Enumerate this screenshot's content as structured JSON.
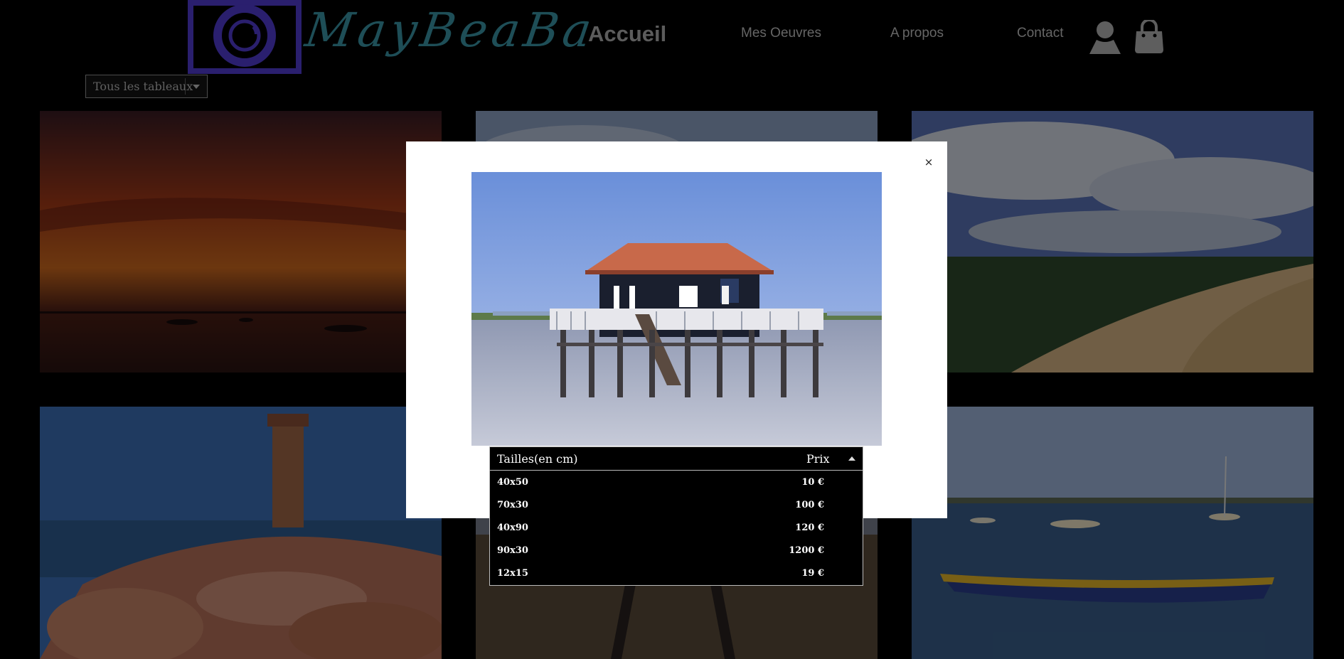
{
  "header": {
    "brand": "MayBeaBa",
    "nav": {
      "home": "Accueil",
      "works": "Mes Oeuvres",
      "about": "A propos",
      "contact": "Contact"
    },
    "icons": [
      "camera-logo-icon",
      "user-icon",
      "shopping-bag-icon"
    ]
  },
  "filter": {
    "selected": "Tous les tableaux"
  },
  "gallery": {
    "tiles": [
      {
        "subject": "sunset-over-water"
      },
      {
        "subject": "cloudy-sky"
      },
      {
        "subject": "sand-dune-and-forest"
      },
      {
        "subject": "lighthouse-on-pink-rocks"
      },
      {
        "subject": "pier-at-dusk"
      },
      {
        "subject": "boats-in-harbor"
      }
    ]
  },
  "modal": {
    "close_label": "×",
    "photo": {
      "subject": "stilt-house-on-water"
    },
    "price_table": {
      "header_size": "Tailles(en cm)",
      "header_price": "Prix",
      "rows": [
        {
          "size": "40x50",
          "price": "10 €"
        },
        {
          "size": "70x30",
          "price": "100 €"
        },
        {
          "size": "40x90",
          "price": "120 €"
        },
        {
          "size": "90x30",
          "price": "1200 €"
        },
        {
          "size": "12x15",
          "price": "19 €"
        }
      ]
    }
  },
  "colors": {
    "background": "#000000",
    "logo_purple": "#2a1f6e",
    "logo_teal": "#1e4e57",
    "modal_bg": "#ffffff",
    "nav_text": "#666666"
  }
}
